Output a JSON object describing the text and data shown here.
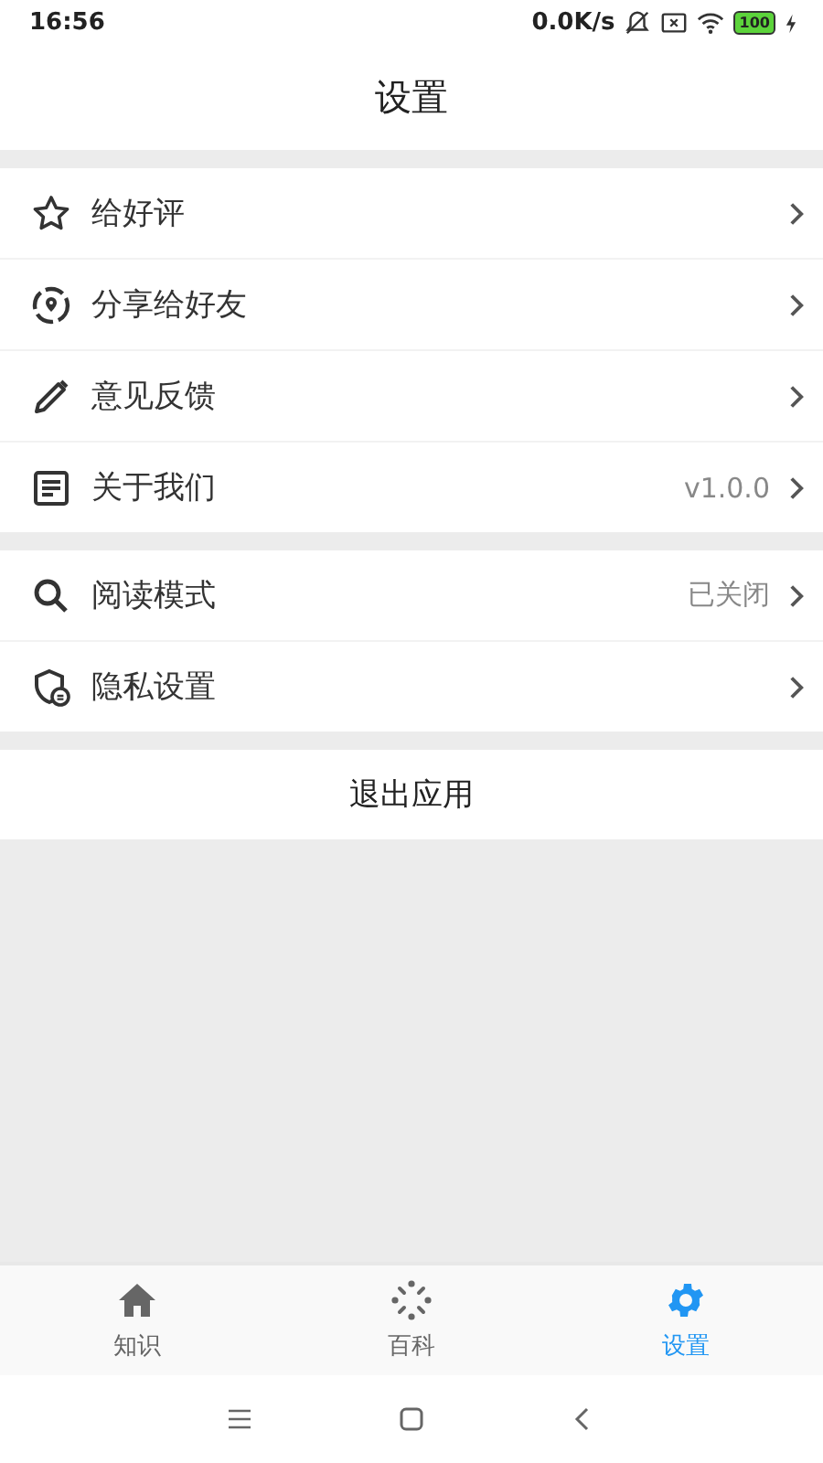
{
  "status_bar": {
    "time": "16:56",
    "speed": "0.0K/s",
    "battery": "100"
  },
  "header": {
    "title": "设置"
  },
  "groups": [
    {
      "items": [
        {
          "label": "给好评"
        },
        {
          "label": "分享给好友"
        },
        {
          "label": "意见反馈"
        },
        {
          "label": "关于我们",
          "value": "v1.0.0"
        }
      ]
    },
    {
      "items": [
        {
          "label": "阅读模式",
          "value": "已关闭"
        },
        {
          "label": "隐私设置"
        }
      ]
    }
  ],
  "exit_button": {
    "label": "退出应用"
  },
  "tabs": [
    {
      "label": "知识",
      "selected": false
    },
    {
      "label": "百科",
      "selected": false
    },
    {
      "label": "设置",
      "selected": true
    }
  ]
}
